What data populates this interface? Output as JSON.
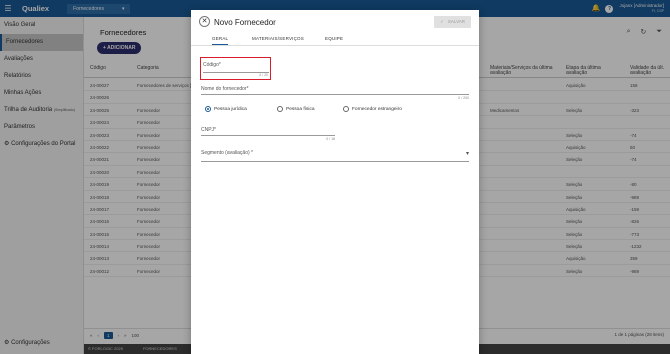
{
  "topbar": {
    "brand": "Qualiex",
    "module": "Fornecedores",
    "user_name": "Jojanx [Administrador]",
    "user_sub": "FI, CSP"
  },
  "sidebar": {
    "items": [
      {
        "label": "Visão Geral"
      },
      {
        "label": "Fornecedores"
      },
      {
        "label": "Avaliações"
      },
      {
        "label": "Relatórios"
      },
      {
        "label": "Minhas Ações"
      },
      {
        "label": "Trilha de Auditoria",
        "badge": "(Simplificado)"
      },
      {
        "label": "Parâmetros"
      },
      {
        "label": "Configurações do Portal"
      }
    ],
    "bottom": "Configurações"
  },
  "main": {
    "title": "Fornecedores",
    "add_label": "+ ADICIONAR",
    "columns": [
      "Código",
      "Categoria",
      "Materiais/Serviços da última avaliação",
      "Etapa da última avaliação",
      "Validade da últ. avaliação"
    ],
    "rows": [
      {
        "code": "24-00027",
        "cat": "Fornecedores de serviços [Removido]",
        "etapa": "Aquisição",
        "val": "158"
      },
      {
        "code": "24-00026",
        "cat": "",
        "etapa": "",
        "val": ""
      },
      {
        "code": "24-00025",
        "cat": "Fornecedor",
        "mat": "Medicamentos",
        "etapa": "Seleção",
        "val": "-323"
      },
      {
        "code": "24-00024",
        "cat": "Fornecedor",
        "etapa": "",
        "val": ""
      },
      {
        "code": "24-00023",
        "cat": "Fornecedor",
        "etapa": "Seleção",
        "val": "-74"
      },
      {
        "code": "24-00022",
        "cat": "Fornecedor",
        "etapa": "Aquisição",
        "val": "50"
      },
      {
        "code": "24-00021",
        "cat": "Fornecedor",
        "etapa": "Seleção",
        "val": "-74"
      },
      {
        "code": "24-00020",
        "cat": "Fornecedor",
        "etapa": "",
        "val": ""
      },
      {
        "code": "24-00019",
        "cat": "Fornecedor",
        "etapa": "Seleção",
        "val": "-80"
      },
      {
        "code": "24-00018",
        "cat": "Fornecedor",
        "etapa": "Seleção",
        "val": "-989"
      },
      {
        "code": "24-00017",
        "cat": "Fornecedor",
        "etapa": "Aquisição",
        "val": "-159"
      },
      {
        "code": "24-00016",
        "cat": "Fornecedor",
        "etapa": "Seleção",
        "val": "-826"
      },
      {
        "code": "24-00015",
        "cat": "Fornecedor",
        "etapa": "Seleção",
        "val": "-773"
      },
      {
        "code": "24-00014",
        "cat": "Fornecedor",
        "etapa": "Seleção",
        "val": "-1232"
      },
      {
        "code": "24-00013",
        "cat": "Fornecedor",
        "etapa": "Aquisição",
        "val": "359"
      },
      {
        "code": "24-00012",
        "cat": "Fornecedor",
        "etapa": "Seleção",
        "val": "-989"
      }
    ],
    "page_size": "100",
    "current_page": "1",
    "pages_info": "1 de 1 páginas (28 itens)",
    "footer_copy": "© FORLOGIC 2025",
    "footer_module": "FORNECEDORES"
  },
  "dialog": {
    "title": "Novo Fornecedor",
    "save_label": "SALVAR",
    "tabs": [
      "GERAL",
      "MATERIAIS/SERVIÇOS",
      "EQUIPE"
    ],
    "codigo_label": "Código*",
    "codigo_counter": "0 / 20",
    "nome_label": "Nome do fornecedor*",
    "nome_counter": "0 / 200",
    "radios": [
      "Pessoa jurídica",
      "Pessoa física",
      "Fornecedor estrangeiro"
    ],
    "cnpj_label": "CNPJ*",
    "cnpj_counter": "0 / 18",
    "segmento_label": "Segmento (avaliação) *"
  }
}
